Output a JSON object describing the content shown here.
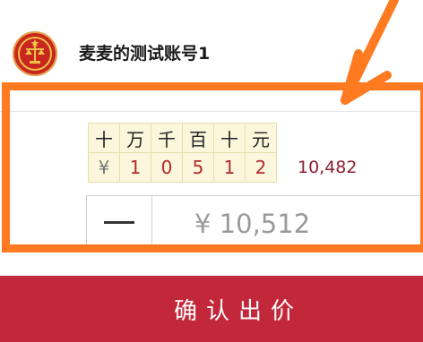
{
  "account": {
    "name": "麦麦的测试账号1"
  },
  "digit_table": {
    "units": [
      "十",
      "万",
      "千",
      "百",
      "十",
      "元"
    ],
    "digits": [
      "¥",
      "1",
      "0",
      "5",
      "1",
      "2"
    ]
  },
  "current_price": "10,482",
  "bid": {
    "minus_label": "—",
    "value": "¥ 10,512"
  },
  "confirm_label": "确认出价",
  "colors": {
    "accent": "#c3273a",
    "highlight": "#ff7a20"
  }
}
